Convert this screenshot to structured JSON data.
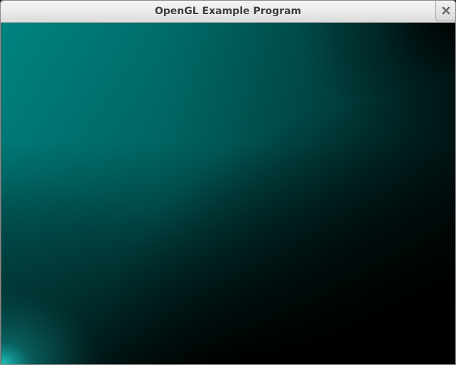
{
  "window": {
    "title": "OpenGL Example Program",
    "close_icon": "close-icon"
  },
  "render": {
    "colors": {
      "teal_bright": "#11b3b0",
      "teal": "#008784",
      "teal_dark": "#005553",
      "black": "#000000"
    }
  }
}
